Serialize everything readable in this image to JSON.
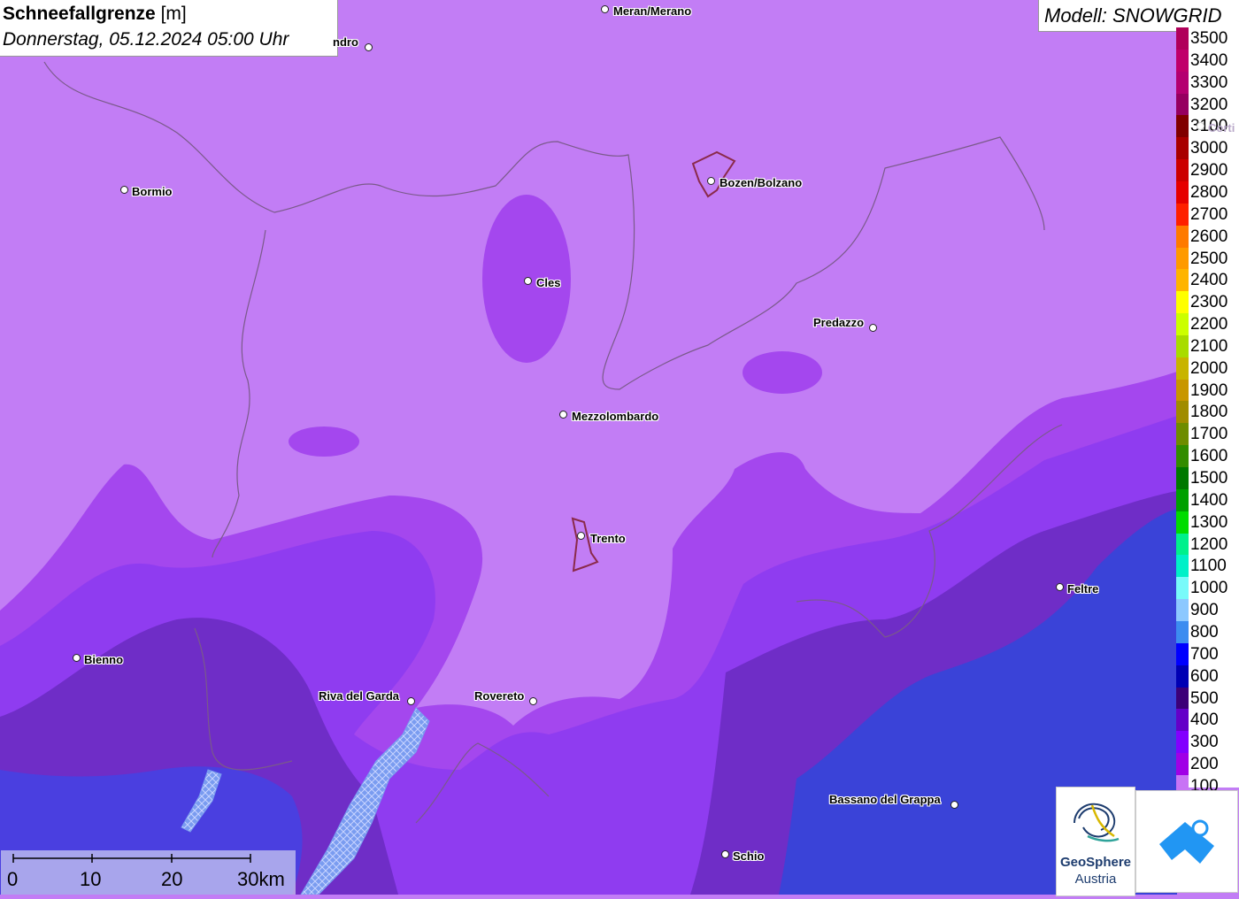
{
  "title": {
    "main": "Schneefallgrenze",
    "unit": "[m]",
    "datetime": "Donnerstag, 05.12.2024 05:00 Uhr"
  },
  "model": "Modell: SNOWGRID",
  "legend": [
    {
      "value": "3500",
      "color": "#b0005a"
    },
    {
      "value": "3400",
      "color": "#c0006a"
    },
    {
      "value": "3300",
      "color": "#b40070"
    },
    {
      "value": "3200",
      "color": "#960060"
    },
    {
      "value": "3100",
      "color": "#800000"
    },
    {
      "value": "3000",
      "color": "#a80000"
    },
    {
      "value": "2900",
      "color": "#cc0000"
    },
    {
      "value": "2800",
      "color": "#e60000"
    },
    {
      "value": "2700",
      "color": "#ff2000"
    },
    {
      "value": "2600",
      "color": "#ff7a00"
    },
    {
      "value": "2500",
      "color": "#ff9a00"
    },
    {
      "value": "2400",
      "color": "#ffb400"
    },
    {
      "value": "2300",
      "color": "#ffff00"
    },
    {
      "value": "2200",
      "color": "#ccff00"
    },
    {
      "value": "2100",
      "color": "#a8dc00"
    },
    {
      "value": "2000",
      "color": "#c8b400"
    },
    {
      "value": "1900",
      "color": "#c89600"
    },
    {
      "value": "1800",
      "color": "#a08c00"
    },
    {
      "value": "1700",
      "color": "#6e8c00"
    },
    {
      "value": "1600",
      "color": "#328c00"
    },
    {
      "value": "1500",
      "color": "#007800"
    },
    {
      "value": "1400",
      "color": "#00a000"
    },
    {
      "value": "1300",
      "color": "#00dc00"
    },
    {
      "value": "1200",
      "color": "#00f08c"
    },
    {
      "value": "1100",
      "color": "#00f0c8"
    },
    {
      "value": "1000",
      "color": "#78fafa"
    },
    {
      "value": "900",
      "color": "#8cc8ff"
    },
    {
      "value": "800",
      "color": "#3c8cf0"
    },
    {
      "value": "700",
      "color": "#0000ff"
    },
    {
      "value": "600",
      "color": "#0000b4"
    },
    {
      "value": "500",
      "color": "#3c0078"
    },
    {
      "value": "400",
      "color": "#6400c8"
    },
    {
      "value": "300",
      "color": "#8200ff"
    },
    {
      "value": "200",
      "color": "#a000e6"
    },
    {
      "value": "100",
      "color": "#c873f5"
    }
  ],
  "places": [
    {
      "name": "Meran/Merano"
    },
    {
      "name": "ndro"
    },
    {
      "name": "Bormio"
    },
    {
      "name": "Bozen/Bolzano"
    },
    {
      "name": "Cles"
    },
    {
      "name": "Predazzo"
    },
    {
      "name": "Mezzolombardo"
    },
    {
      "name": "Trento"
    },
    {
      "name": "Feltre"
    },
    {
      "name": "Bienno"
    },
    {
      "name": "Riva del Garda"
    },
    {
      "name": "Rovereto"
    },
    {
      "name": "Bassano del Grappa"
    },
    {
      "name": "Schio"
    },
    {
      "name": "Corti"
    }
  ],
  "scale": {
    "labels": [
      "0",
      "10",
      "20",
      "30km"
    ]
  },
  "logos": {
    "geosphere_line1": "GeoSphere",
    "geosphere_line2": "Austria"
  }
}
